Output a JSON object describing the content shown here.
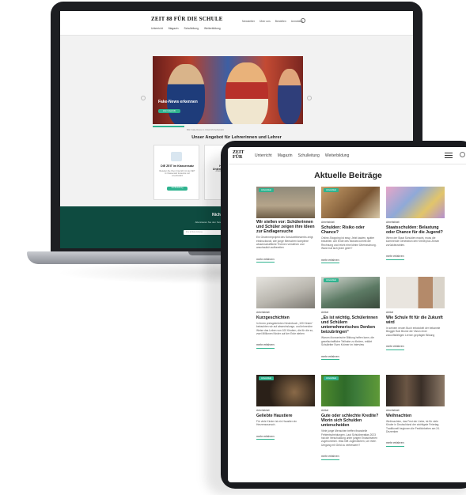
{
  "laptop": {
    "logo": "ZEIT 88 FÜR DIE SCHULE",
    "subnav": [
      "Unterricht",
      "Magazin",
      "Schulleitung",
      "Weiterbildung"
    ],
    "topnav": [
      "Newsletter",
      "Über uns",
      "Bestellen",
      "Anmelden"
    ],
    "hero": {
      "title": "Fake-News erkennen",
      "button": "Zum Unterricht"
    },
    "caption": "Bild: Fake-News im Unterricht behandeln",
    "section_title": "Unser Angebot für Lehrerinnen und Lehrer",
    "cards": [
      {
        "title": "DIE ZEIT im Klassensatz",
        "text": "Bestellen Sie Ihren Unterricht mit der ZEIT im Klassensatz kostenlos und unverbindlich",
        "button": "Zur Bestellung"
      },
      {
        "title": "Hochwertige Unterrichtsmaterialien",
        "text": "Arbeitsblätter und Materialien",
        "button": ""
      }
    ],
    "footer": {
      "title": "Nichts verpassen",
      "text": "Abonnieren Sie den Newsletter für neue Arbeitsblätter, Veranstaltungen",
      "input_placeholder": "Ihre E-Mail-Adresse"
    }
  },
  "tablet": {
    "logo": "ZEIT FÜR",
    "nav": [
      "Unterricht",
      "Magazin",
      "Schulleitung",
      "Weiterbildung"
    ],
    "title": "Aktuelle Beiträge",
    "cards": [
      {
        "badge": "Arbeitsblatt",
        "kicker": "",
        "title": "Wir stellen vor: Schülerinnen und Schüler zeigen ihre Ideen zur Endlagersuche",
        "text": "Ein Gewinnerprojekt des Schulwettbewerbs zeigt eindrucksvoll, wie junge Menschen komplexe wissenschaftliche Themen verstehen und anschaulich aufbereiten",
        "more": "mehr erfahren",
        "img": "#b4a489"
      },
      {
        "badge": "Arbeitsblatt",
        "kicker": "Arbeitsblatt",
        "title": "Schulden: Risiko oder Chance?",
        "text": "Online-Shopping ist easy. Jetzt kaufen, später bezahlen. Am Ende des Monats kommt die Rechnung und reicht eine kleine Überraschung. Wann hat sich jeder geirrt?",
        "more": "mehr erfahren",
        "img": "#a77a4c"
      },
      {
        "badge": "",
        "kicker": "Arbeitsblatt",
        "title": "Staatsschulden: Belastung oder Chance für die Jugend?",
        "text": "Wenn der Staat Schulden macht, muss die kommende Generation den Kredit plus Zinsen zurückbezahlen.",
        "more": "mehr erfahren",
        "img": "#9f88b6"
      },
      {
        "badge": "",
        "kicker": "Arbeitsblatt",
        "title": "Kurzgeschichten",
        "text": "In ihrem preisgekrönten Kinderbuch „100 Kinder“ betrachten wir auf abwechslungs- und lehrreiche Weise das Leben von 100 Kindern, die für die so, zwei Millionen Kinder auf der Erde stehen",
        "more": "mehr erfahren",
        "img": "#cfcdc8"
      },
      {
        "badge": "Arbeitsblatt",
        "kicker": "Artikel",
        "title": "„Es ist wichtig, Schülerinnen und Schülern unternehmerisches Denken beizubringen“",
        "text": "Warum ökonomische Bildung helfen kann, die gesellschaftliche Teilhabe zu fördern, erklärt Schulleiter Sven Krömer im Interview",
        "more": "mehr erfahren",
        "img": "#6f8f7a"
      },
      {
        "badge": "",
        "kicker": "Artikel",
        "title": "Wie Schule fit für die Zukunft wird",
        "text": "In seinem neuen Buch entwickelt der bekannte Blogger Bob Blume die Vision einer zukunftsfähigen Lernen geprägter Bildung",
        "more": "mehr erfahren",
        "img": "#c9c3bb"
      },
      {
        "badge": "Arbeitsblatt",
        "kicker": "Arbeitsblatt",
        "title": "Geliebte Haustiere",
        "text": "Für viele Kinder ist ein Haustier ein Herzenswunsch.",
        "more": "mehr erfahren",
        "img": "#3b2e24"
      },
      {
        "badge": "Arbeitsblatt",
        "kicker": "Artikel",
        "title": "Gute oder schlechte Kredite? Worin sich Schulden unterscheiden",
        "text": "Viele junge Menschen treffen finanzielle Fehlentscheidungen. Laut Schuldneratlas 2023 hat die Verschuldung unter jungen Erwachsenen zugenommen. Was hilft Jugendlichen, um ihren Umgang mit Geld zu verbessern?",
        "more": "mehr erfahren",
        "img": "#3a7d3a"
      },
      {
        "badge": "",
        "kicker": "Arbeitsblatt",
        "title": "Weihnachten",
        "text": "Weihnachten, das Fest der Liebe, ist für viele Kinder in Deutschland der wichtigste Feiertag. Traditionell beginnen die Festlichkeiten am 24. Dezember",
        "more": "mehr erfahren",
        "img": "#5a4a3a"
      }
    ]
  },
  "colors": {
    "accent": "#2fb38f",
    "footer": "#0e4b40",
    "device": "#1a1b1f"
  }
}
